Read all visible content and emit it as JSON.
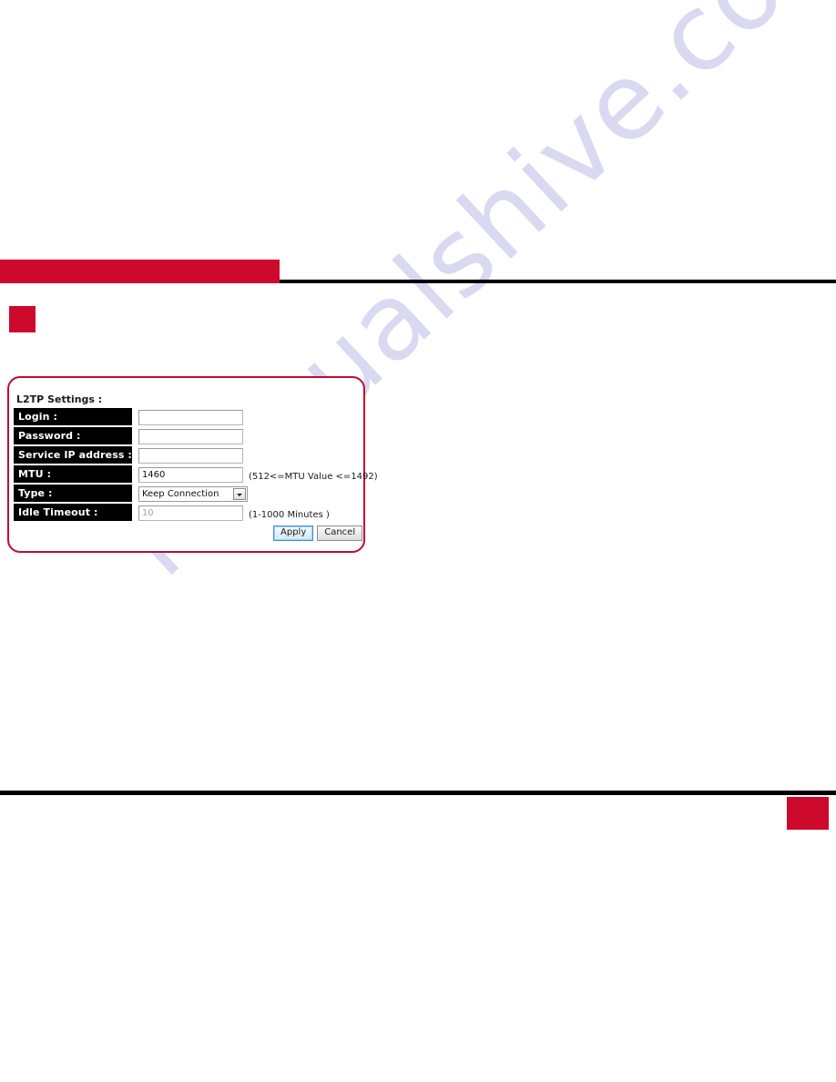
{
  "document": {
    "watermark": "manualshive.com",
    "header_band_text": "",
    "section_marker_text": "",
    "footer_badge_text": ""
  },
  "panel": {
    "title": "L2TP Settings :",
    "border_color": "#c10b30",
    "rows": [
      {
        "label": "Login :",
        "control": "text",
        "value": "",
        "hint": ""
      },
      {
        "label": "Password :",
        "control": "text",
        "value": "",
        "hint": ""
      },
      {
        "label": "Service IP address :",
        "control": "text",
        "value": "",
        "hint": ""
      },
      {
        "label": "MTU :",
        "control": "text",
        "value": "1460",
        "hint": "(512<=MTU Value <=1492)"
      },
      {
        "label": "Type :",
        "control": "select",
        "value": "Keep Connection",
        "hint": ""
      },
      {
        "label": "Idle Timeout :",
        "control": "text",
        "value": "10",
        "hint": "(1-1000 Minutes )",
        "disabled": true
      }
    ],
    "buttons": {
      "apply": "Apply",
      "cancel": "Cancel"
    }
  },
  "colors": {
    "brand_red": "#ce0a2c",
    "panel_border": "#c10b30",
    "label_bar": "#000000",
    "watermark": "#d7d8f2"
  }
}
